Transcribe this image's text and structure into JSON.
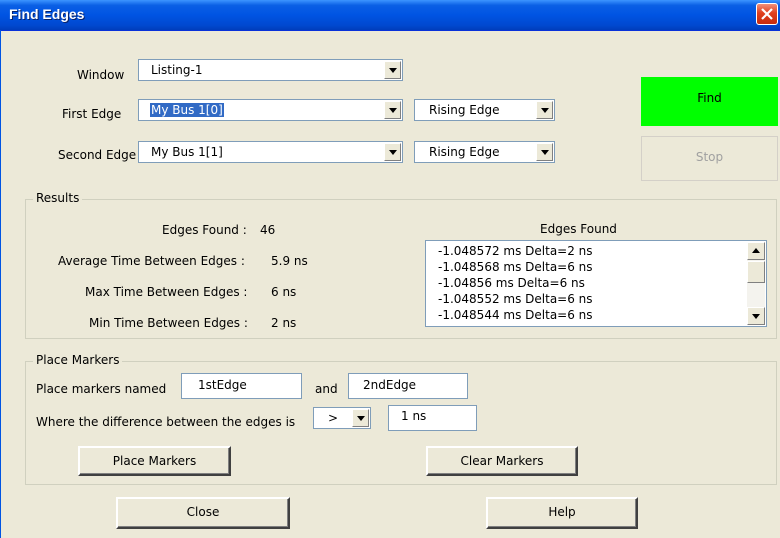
{
  "window": {
    "title": "Find Edges"
  },
  "search": {
    "window_label": "Window",
    "window_value": "Listing-1",
    "first_edge_label": "First Edge",
    "first_edge_value": "My Bus 1[0]",
    "first_edge_type": "Rising Edge",
    "second_edge_label": "Second Edge",
    "second_edge_value": "My Bus 1[1]",
    "second_edge_type": "Rising Edge"
  },
  "actions": {
    "find": "Find",
    "stop": "Stop",
    "find_color": "#00ff00"
  },
  "results": {
    "group_label": "Results",
    "edges_found_label": "Edges Found :",
    "edges_found_value": "46",
    "avg_label": "Average Time Between Edges :",
    "avg_value": "5.9 ns",
    "max_label": "Max Time Between Edges :",
    "max_value": "6 ns",
    "min_label": "Min Time Between Edges :",
    "min_value": "2 ns",
    "list_header": "Edges Found",
    "list_items": [
      "-1.048572 ms Delta=2 ns",
      "-1.048568 ms Delta=6 ns",
      "-1.04856 ms Delta=6 ns",
      "-1.048552 ms Delta=6 ns",
      "-1.048544 ms Delta=6 ns"
    ]
  },
  "markers": {
    "group_label": "Place Markers",
    "named_label": "Place markers named",
    "first_name": "1stEdge",
    "and_label": "and",
    "second_name": "2ndEdge",
    "difference_label": "Where the difference between the edges is",
    "operator": ">",
    "difference_value": "1 ns",
    "place_button": "Place Markers",
    "clear_button": "Clear Markers"
  },
  "footer": {
    "close": "Close",
    "help": "Help"
  }
}
